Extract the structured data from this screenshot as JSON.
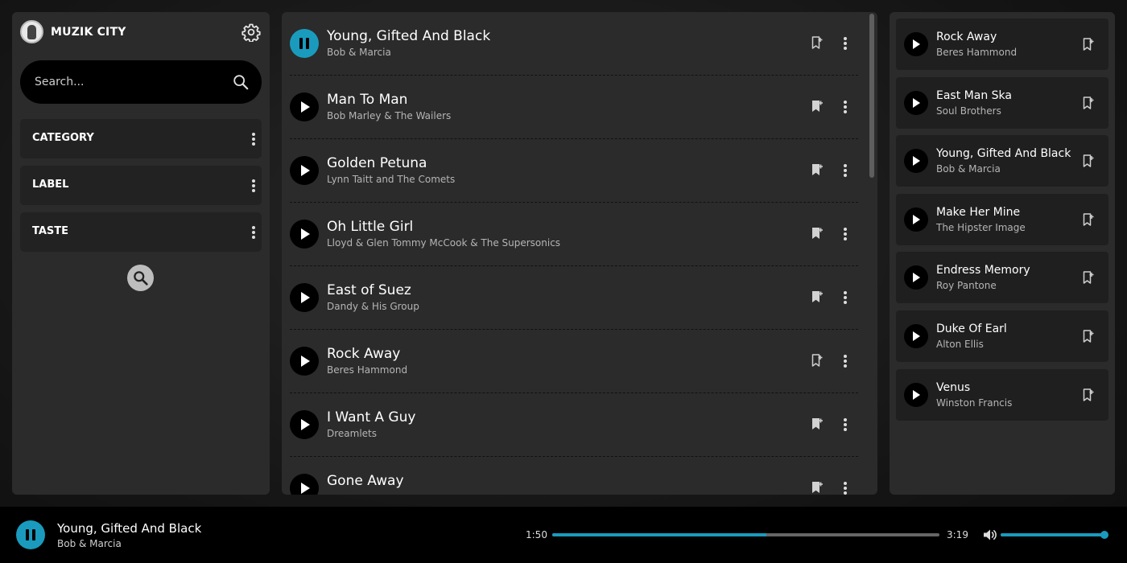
{
  "app": {
    "name": "MUZIK CITY"
  },
  "search": {
    "placeholder": "Search..."
  },
  "filters": [
    {
      "label": "CATEGORY"
    },
    {
      "label": "LABEL"
    },
    {
      "label": "TASTE"
    }
  ],
  "tracks": [
    {
      "title": "Young, Gifted And Black",
      "artist": "Bob & Marcia",
      "playing": true,
      "bookmarked": false
    },
    {
      "title": "Man To Man",
      "artist": "Bob Marley & The Wailers",
      "playing": false,
      "bookmarked": true
    },
    {
      "title": "Golden Petuna",
      "artist": "Lynn Taitt and The Comets",
      "playing": false,
      "bookmarked": true
    },
    {
      "title": "Oh Little Girl",
      "artist": "Lloyd & Glen Tommy McCook & The Supersonics",
      "playing": false,
      "bookmarked": true
    },
    {
      "title": "East of Suez",
      "artist": "Dandy & His Group",
      "playing": false,
      "bookmarked": true
    },
    {
      "title": "Rock Away",
      "artist": "Beres Hammond",
      "playing": false,
      "bookmarked": false
    },
    {
      "title": "I Want A Guy",
      "artist": "Dreamlets",
      "playing": false,
      "bookmarked": true
    },
    {
      "title": "Gone Away",
      "artist": "",
      "playing": false,
      "bookmarked": true
    }
  ],
  "queue": [
    {
      "title": "Rock Away",
      "artist": "Beres Hammond"
    },
    {
      "title": "East Man Ska",
      "artist": "Soul Brothers"
    },
    {
      "title": "Young, Gifted And Black",
      "artist": "Bob & Marcia"
    },
    {
      "title": "Make Her Mine",
      "artist": "The Hipster Image"
    },
    {
      "title": "Endress Memory",
      "artist": "Roy Pantone"
    },
    {
      "title": "Duke Of Earl",
      "artist": "Alton Ellis"
    },
    {
      "title": "Venus",
      "artist": "Winston Francis"
    }
  ],
  "player": {
    "title": "Young, Gifted And Black",
    "artist": "Bob & Marcia",
    "elapsed": "1:50",
    "duration": "3:19",
    "progress": 0.553,
    "volume": 0.97
  },
  "colors": {
    "accent": "#1a9bbd",
    "panel": "#2b2b2b",
    "card": "#1f1f1f"
  },
  "icons": {
    "settings": "gear-icon",
    "search": "search-icon",
    "more": "kebab-icon",
    "bookmark": "bookmark-icon",
    "play": "play-icon",
    "pause": "pause-icon",
    "volume": "volume-icon"
  }
}
